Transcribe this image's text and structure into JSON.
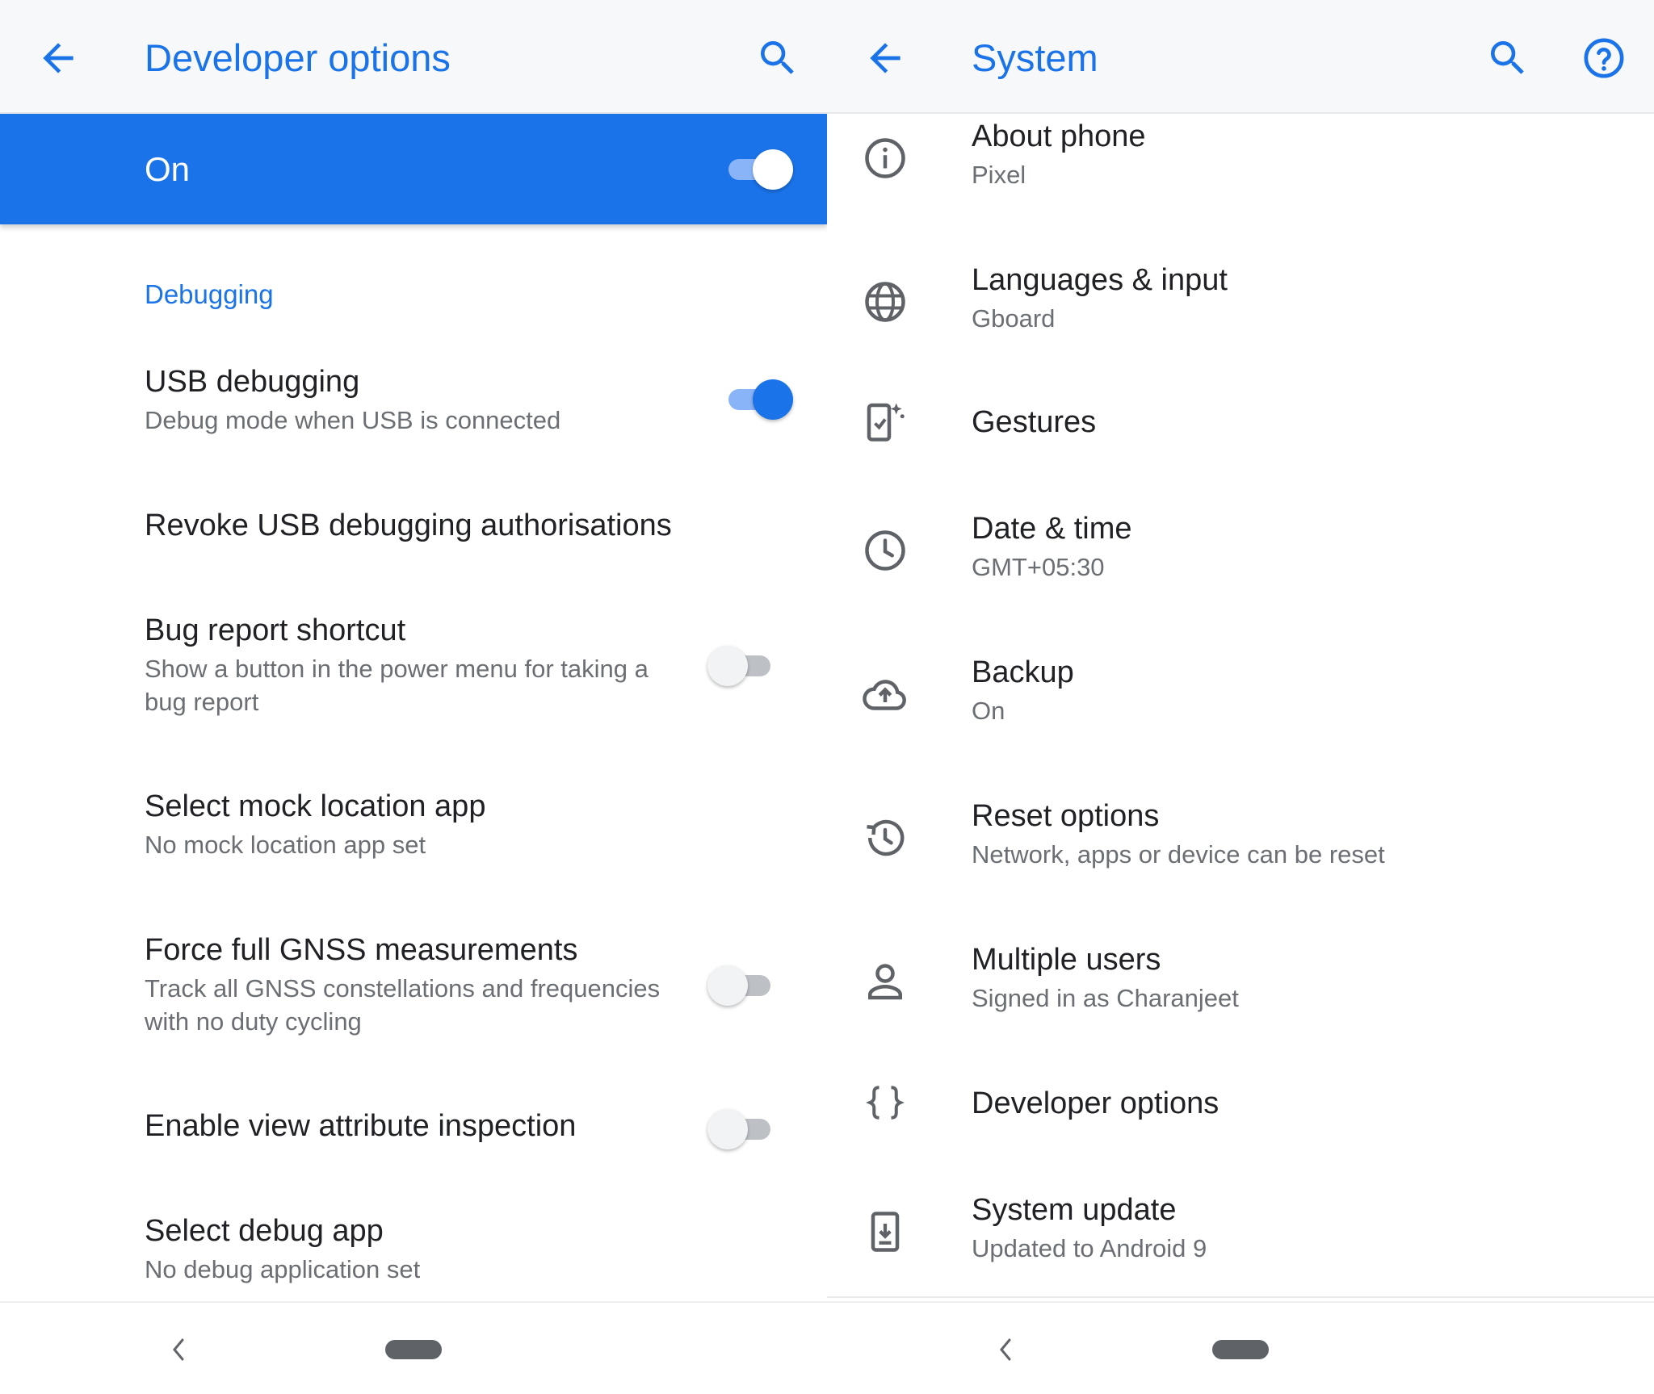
{
  "colors": {
    "accent": "#1a73e8",
    "text_primary": "#202124",
    "text_secondary": "#6b6f73",
    "icon_gray": "#5f6368"
  },
  "left": {
    "appbar": {
      "title": "Developer options",
      "back_icon": "arrow-back-icon",
      "search_icon": "search-icon"
    },
    "master_switch": {
      "label": "On",
      "state": "on"
    },
    "section_header": "Debugging",
    "items": [
      {
        "title": "USB debugging",
        "subtitle": "Debug mode when USB is connected",
        "toggle": "on"
      },
      {
        "title": "Revoke USB debugging authorisations"
      },
      {
        "title": "Bug report shortcut",
        "subtitle": "Show a button in the power menu for taking a bug report",
        "toggle": "off"
      },
      {
        "title": "Select mock location app",
        "subtitle": "No mock location app set"
      },
      {
        "title": "Force full GNSS measurements",
        "subtitle": "Track all GNSS constellations and frequencies with no duty cycling",
        "toggle": "off"
      },
      {
        "title": "Enable view attribute inspection",
        "toggle": "off"
      },
      {
        "title": "Select debug app",
        "subtitle": "No debug application set"
      }
    ]
  },
  "right": {
    "appbar": {
      "title": "System",
      "back_icon": "arrow-back-icon",
      "search_icon": "search-icon",
      "help_icon": "help-icon"
    },
    "items": [
      {
        "icon": "info-icon",
        "title": "About phone",
        "subtitle": "Pixel"
      },
      {
        "icon": "globe-icon",
        "title": "Languages & input",
        "subtitle": "Gboard"
      },
      {
        "icon": "gestures-icon",
        "title": "Gestures"
      },
      {
        "icon": "clock-icon",
        "title": "Date & time",
        "subtitle": "GMT+05:30"
      },
      {
        "icon": "cloud-upload-icon",
        "title": "Backup",
        "subtitle": "On"
      },
      {
        "icon": "history-icon",
        "title": "Reset options",
        "subtitle": "Network, apps or device can be reset"
      },
      {
        "icon": "person-icon",
        "title": "Multiple users",
        "subtitle": "Signed in as Charanjeet"
      },
      {
        "icon": "braces-icon",
        "title": "Developer options"
      },
      {
        "icon": "system-update-icon",
        "title": "System update",
        "subtitle": "Updated to Android 9"
      }
    ]
  },
  "navbar": {
    "back_icon": "nav-back-icon",
    "home_icon": "home-pill-icon"
  }
}
